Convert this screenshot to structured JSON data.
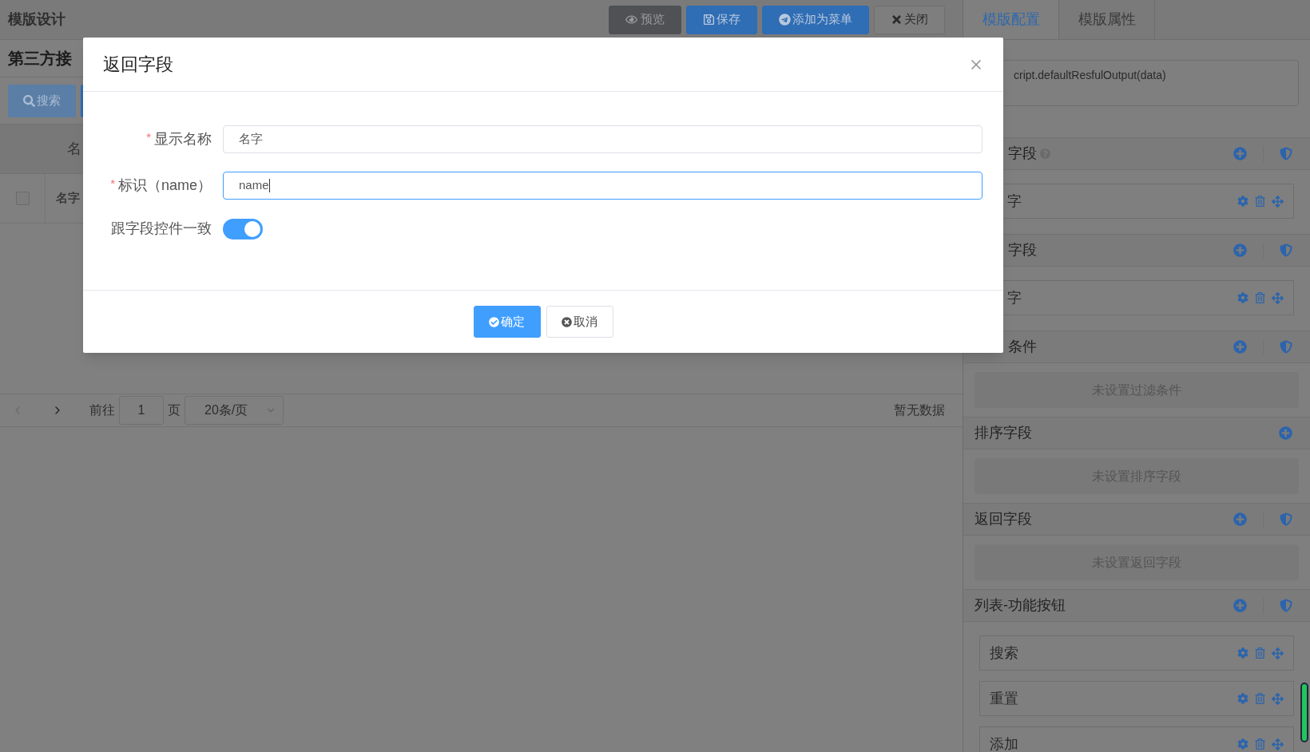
{
  "header": {
    "title": "模版设计",
    "buttons": [
      {
        "kind": "dark",
        "label": "预览"
      },
      {
        "kind": "primary",
        "label": "保存"
      },
      {
        "kind": "primary",
        "label": "添加为菜单"
      },
      {
        "kind": "plain",
        "label": "关闭"
      }
    ]
  },
  "page": {
    "title": "第三方接",
    "search_button": "搜索",
    "table": {
      "header": "名",
      "rows": [
        {
          "cell": "名字",
          "checked": false
        }
      ]
    },
    "pagination": {
      "goto_label": "前往",
      "page": "1",
      "page_unit": "页",
      "page_size": "20条/页",
      "total": "暂无数据"
    }
  },
  "side_tabs": [
    {
      "label": "模版配置",
      "selected": true
    },
    {
      "label": "模版属性",
      "selected": false
    }
  ],
  "side": {
    "script": "cript.defaultResfulOutput(data)",
    "sections": [
      {
        "title": "字段",
        "help": true,
        "clipped": true,
        "shield": true,
        "items": [
          {
            "label": "字",
            "clipped": true
          }
        ]
      },
      {
        "title": "字段",
        "help": false,
        "clipped": true,
        "shield": true,
        "items": [
          {
            "label": "字",
            "clipped": true
          }
        ]
      },
      {
        "title": "条件",
        "help": false,
        "clipped": true,
        "shield": true,
        "empty": "未设置过滤条件"
      },
      {
        "title": "排序字段",
        "help": false,
        "clipped": false,
        "shield": false,
        "empty": "未设置排序字段"
      },
      {
        "title": "返回字段",
        "help": false,
        "clipped": false,
        "shield": true,
        "empty": "未设置返回字段"
      },
      {
        "title": "列表-功能按钮",
        "help": false,
        "clipped": false,
        "shield": true,
        "items": [
          {
            "label": "搜索",
            "clipped": false
          },
          {
            "label": "重置",
            "clipped": false
          },
          {
            "label": "添加",
            "clipped": false
          }
        ]
      }
    ]
  },
  "dialog": {
    "title": "返回字段",
    "fields": [
      {
        "kind": "text",
        "required_mark": "*",
        "label": "显示名称",
        "value": "名字",
        "focused": false
      },
      {
        "kind": "text",
        "required_mark": "*",
        "label": "标识（name）",
        "value": "name",
        "focused": true
      },
      {
        "kind": "switch",
        "label": "跟字段控件一致",
        "on": true
      }
    ],
    "buttons": [
      {
        "kind": "primary",
        "label": "确定"
      },
      {
        "kind": "default",
        "label": "取消"
      }
    ]
  }
}
